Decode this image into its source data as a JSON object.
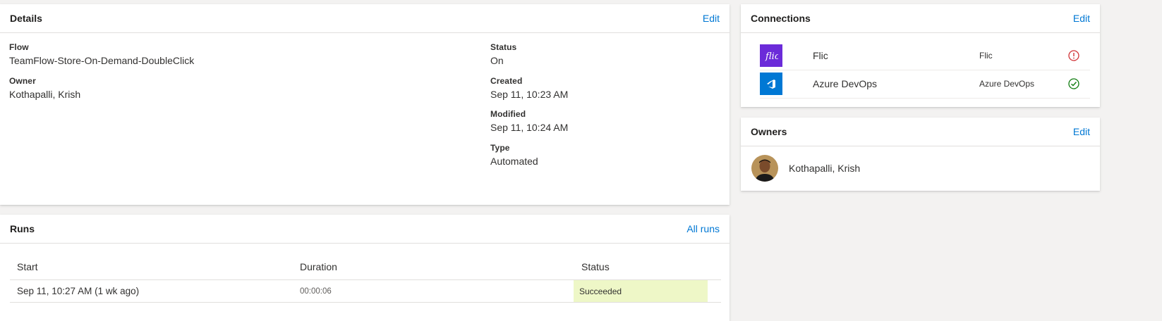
{
  "details": {
    "title": "Details",
    "edit_label": "Edit",
    "fields": {
      "flow": {
        "label": "Flow",
        "value": "TeamFlow-Store-On-Demand-DoubleClick"
      },
      "owner": {
        "label": "Owner",
        "value": "Kothapalli, Krish"
      },
      "status": {
        "label": "Status",
        "value": "On"
      },
      "created": {
        "label": "Created",
        "value": "Sep 11, 10:23 AM"
      },
      "modified": {
        "label": "Modified",
        "value": "Sep 11, 10:24 AM"
      },
      "type": {
        "label": "Type",
        "value": "Automated"
      }
    }
  },
  "connections": {
    "title": "Connections",
    "edit_label": "Edit",
    "items": [
      {
        "name": "Flic",
        "type": "Flic",
        "icon": "flic-icon",
        "icon_color": "#6b2bd9",
        "status": "error-icon",
        "status_color": "#d13438"
      },
      {
        "name": "Azure DevOps",
        "type": "Azure DevOps",
        "icon": "azure-devops-icon",
        "icon_color": "#0078d4",
        "status": "success-icon",
        "status_color": "#107c10"
      }
    ]
  },
  "owners": {
    "title": "Owners",
    "edit_label": "Edit",
    "items": [
      {
        "name": "Kothapalli, Krish",
        "icon": "avatar"
      }
    ]
  },
  "runs": {
    "title": "Runs",
    "all_runs_label": "All runs",
    "columns": [
      "Start",
      "Duration",
      "Status"
    ],
    "rows": [
      {
        "start": "Sep 11, 10:27 AM (1 wk ago)",
        "duration": "00:00:06",
        "status": "Succeeded",
        "status_bg": "#eef7c7"
      }
    ]
  }
}
